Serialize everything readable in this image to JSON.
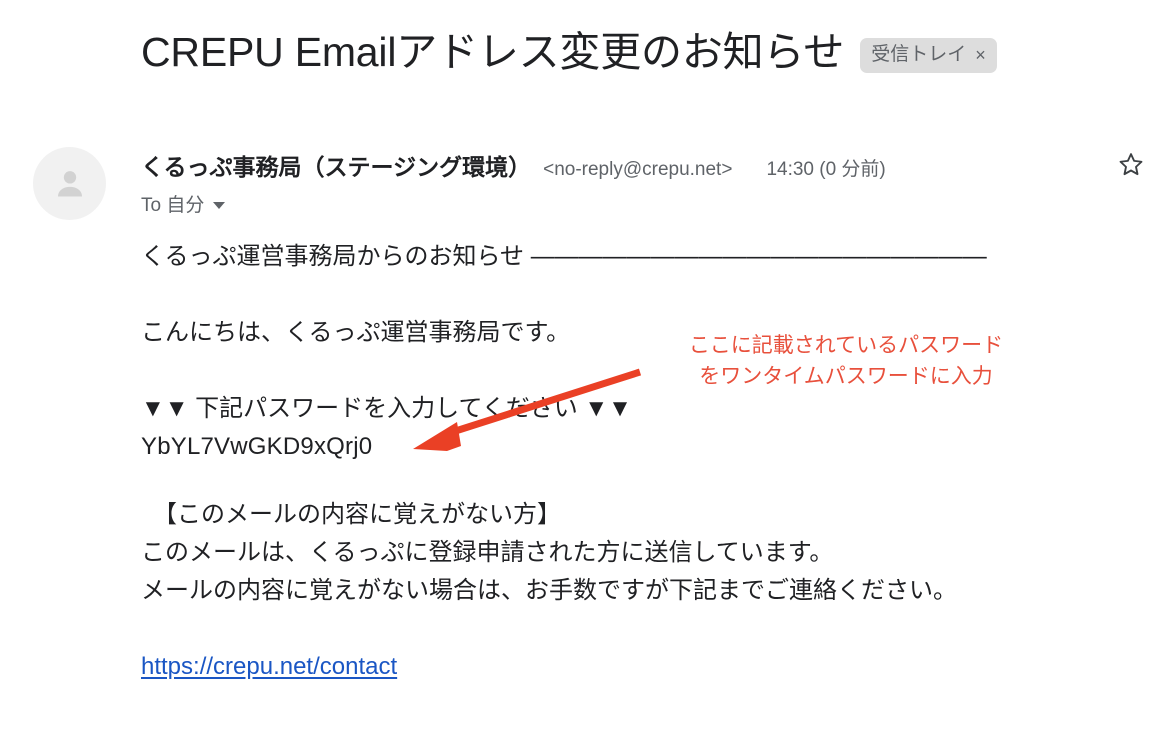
{
  "email": {
    "subject": "CREPU Emailアドレス変更のお知らせ",
    "label": {
      "name": "受信トレイ",
      "close": "×"
    },
    "sender": {
      "name": "くるっぷ事務局（ステージング環境）",
      "address": "<no-reply@crepu.net>",
      "time": "14:30 (0 分前)"
    },
    "recipient": "To 自分",
    "avatar_icon": "person-icon",
    "star_icon": "star-outline-icon",
    "caret_icon": "chevron-down-icon",
    "body": {
      "line1": "くるっぷ運営事務局からのお知らせ ———————————————————",
      "line2": "こんにちは、くるっぷ運営事務局です。",
      "line3": "▼▼ 下記パスワードを入力してください ▼▼",
      "password": "YbYL7VwGKD9xQrj0",
      "line5": "【このメールの内容に覚えがない方】",
      "line6": "このメールは、くるっぷに登録申請された方に送信しています。",
      "line7": "メールの内容に覚えがない場合は、お手数ですが下記までご連絡ください。",
      "link": "https://crepu.net/contact"
    }
  },
  "annotation": {
    "text": "ここに記載されているパスワード\nをワンタイムパスワードに入力",
    "color": "#e8503c",
    "arrow_color": "#ea4025"
  },
  "colors": {
    "text_primary": "#202124",
    "text_secondary": "#5f6368",
    "link": "#1a56c4",
    "chip_bg": "#dddddd",
    "avatar_bg": "#f1f1f1"
  }
}
